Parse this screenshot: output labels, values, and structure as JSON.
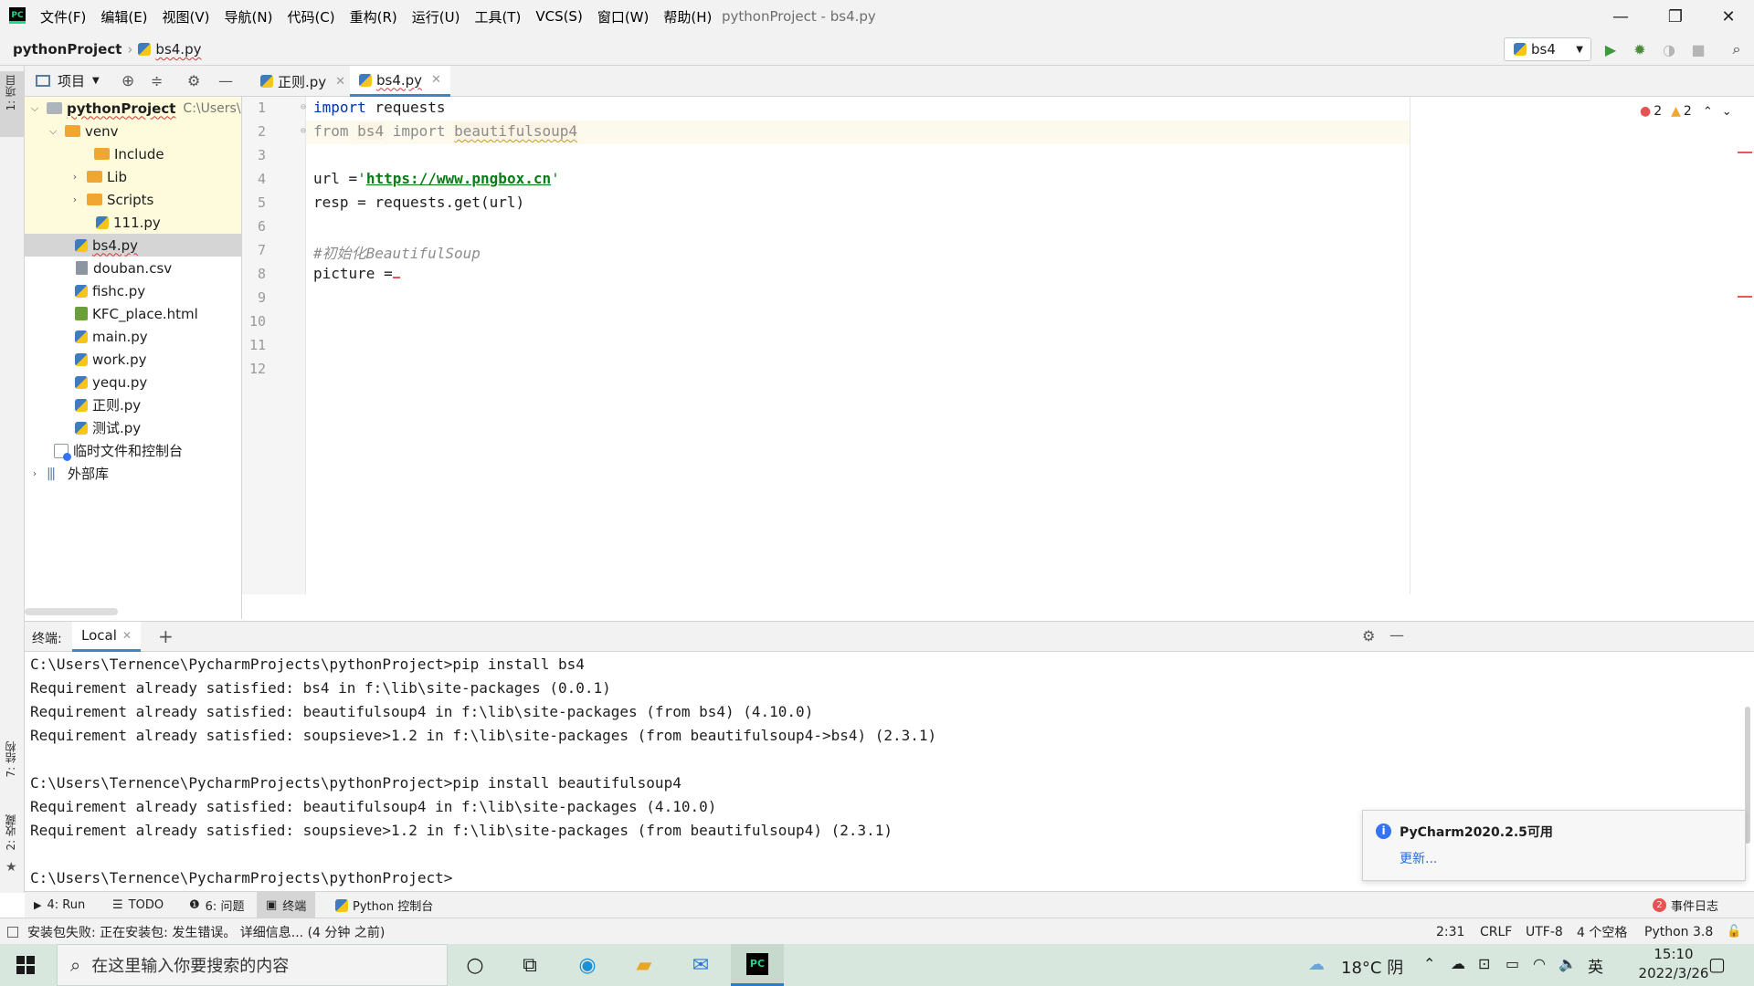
{
  "window": {
    "title": "pythonProject - bs4.py",
    "menu": [
      "文件(F)",
      "编辑(E)",
      "视图(V)",
      "导航(N)",
      "代码(C)",
      "重构(R)",
      "运行(U)",
      "工具(T)",
      "VCS(S)",
      "窗口(W)",
      "帮助(H)"
    ],
    "minimize": "—",
    "restore": "❐",
    "close": "✕"
  },
  "navbar": {
    "project": "pythonProject",
    "file": "bs4.py",
    "run_config": "bs4"
  },
  "left_strip": {
    "project_label": "1: 项目",
    "structure_label": "7: 结构",
    "favorites_label": "2: 收藏"
  },
  "project_panel": {
    "title": "项目",
    "tree": [
      {
        "label": "pythonProject",
        "extra": "C:\\Users\\"
      },
      {
        "label": "venv"
      },
      {
        "label": "Include"
      },
      {
        "label": "Lib"
      },
      {
        "label": "Scripts"
      },
      {
        "label": "111.py"
      },
      {
        "label": "bs4.py"
      },
      {
        "label": "douban.csv"
      },
      {
        "label": "fishc.py"
      },
      {
        "label": "KFC_place.html"
      },
      {
        "label": "main.py"
      },
      {
        "label": "work.py"
      },
      {
        "label": "yequ.py"
      },
      {
        "label": "正则.py"
      },
      {
        "label": "测试.py"
      },
      {
        "label": "临时文件和控制台"
      },
      {
        "label": "外部库"
      }
    ]
  },
  "editor": {
    "tabs": [
      {
        "label": "正则.py"
      },
      {
        "label": "bs4.py"
      }
    ],
    "line_numbers": [
      "1",
      "2",
      "3",
      "4",
      "5",
      "6",
      "7",
      "8",
      "9",
      "10",
      "11",
      "12"
    ],
    "code": {
      "l1_kw": "import",
      "l1_rest": " requests",
      "l2_from": "from",
      "l2_mod": "bs4",
      "l2_import": "import",
      "l2_name": "beautifulsoup4",
      "l4_a": "url =",
      "l4_q1": "'",
      "l4_url": "https://www.pngbox.cn",
      "l4_q2": "'",
      "l5": "resp = requests.get(url)",
      "l7": "#初始化BeautifulSoup",
      "l8": "picture ="
    },
    "inspection": {
      "errors": "2",
      "warnings": "2"
    }
  },
  "terminal": {
    "label": "终端:",
    "tab": "Local",
    "lines": [
      "C:\\Users\\Ternence\\PycharmProjects\\pythonProject>pip install bs4",
      "Requirement already satisfied: bs4 in f:\\lib\\site-packages (0.0.1)",
      "Requirement already satisfied: beautifulsoup4 in f:\\lib\\site-packages (from bs4) (4.10.0)",
      "Requirement already satisfied: soupsieve>1.2 in f:\\lib\\site-packages (from beautifulsoup4->bs4) (2.3.1)",
      "",
      "C:\\Users\\Ternence\\PycharmProjects\\pythonProject>pip install beautifulsoup4",
      "Requirement already satisfied: beautifulsoup4 in f:\\lib\\site-packages (4.10.0)",
      "Requirement already satisfied: soupsieve>1.2 in f:\\lib\\site-packages (from beautifulsoup4) (2.3.1)",
      "",
      "C:\\Users\\Ternence\\PycharmProjects\\pythonProject>"
    ]
  },
  "notification": {
    "title": "PyCharm2020.2.5可用",
    "link": "更新..."
  },
  "bottom_tools": {
    "run": "4: Run",
    "todo": "TODO",
    "problems": "6: 问题",
    "terminal": "终端",
    "console": "Python 控制台",
    "event_log": "事件日志",
    "event_count": "2"
  },
  "status": {
    "message": "安装包失败: 正在安装包: 发生错误。 详细信息... (4 分钟 之前)",
    "position": "2:31",
    "line_sep": "CRLF",
    "encoding": "UTF-8",
    "indent": "4 个空格",
    "interpreter": "Python 3.8"
  },
  "taskbar": {
    "search_placeholder": "在这里输入你要搜索的内容",
    "weather": "18°C 阴",
    "ime": "英",
    "time": "15:10",
    "date": "2022/3/26"
  },
  "colors": {
    "accent": "#4083c9",
    "keyword": "#0033b3",
    "string": "#067d17",
    "error": "#e55353",
    "warning": "#f0a732"
  }
}
